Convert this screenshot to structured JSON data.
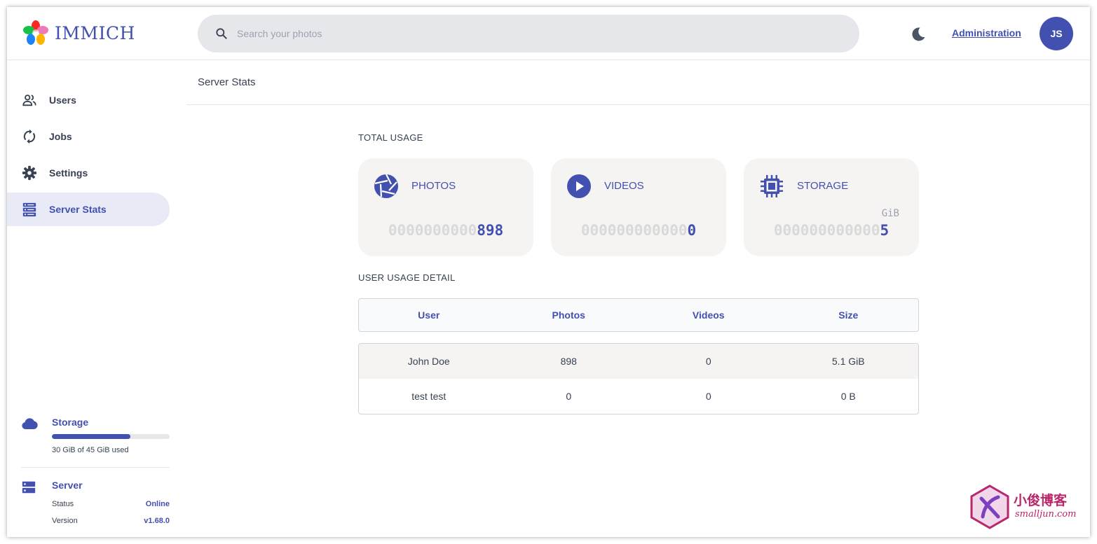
{
  "app": {
    "name": "IMMICH"
  },
  "header": {
    "search_placeholder": "Search your photos",
    "admin_link": "Administration",
    "avatar_initials": "JS"
  },
  "sidebar": {
    "items": [
      {
        "label": "Users",
        "icon": "users-icon",
        "active": false
      },
      {
        "label": "Jobs",
        "icon": "sync-icon",
        "active": false
      },
      {
        "label": "Settings",
        "icon": "gear-icon",
        "active": false
      },
      {
        "label": "Server Stats",
        "icon": "server-icon",
        "active": true
      }
    ],
    "storage": {
      "title": "Storage",
      "used_text": "30 GiB of 45 GiB used",
      "used_fraction": 0.667
    },
    "server": {
      "title": "Server",
      "status_label": "Status",
      "status_value": "Online",
      "version_label": "Version",
      "version_value": "v1.68.0"
    }
  },
  "main": {
    "page_title": "Server Stats",
    "total_usage_label": "TOTAL USAGE",
    "cards": [
      {
        "label": "PHOTOS",
        "icon": "camera-iris-icon",
        "padding": "0000000000",
        "value": "898",
        "unit": ""
      },
      {
        "label": "VIDEOS",
        "icon": "play-circle-icon",
        "padding": "000000000000",
        "value": "0",
        "unit": ""
      },
      {
        "label": "STORAGE",
        "icon": "chip-icon",
        "padding": "000000000000",
        "value": "5",
        "unit": "GiB"
      }
    ],
    "user_usage_label": "USER USAGE DETAIL",
    "table": {
      "headers": [
        "User",
        "Photos",
        "Videos",
        "Size"
      ],
      "rows": [
        [
          "John Doe",
          "898",
          "0",
          "5.1 GiB"
        ],
        [
          "test test",
          "0",
          "0",
          "0 B"
        ]
      ]
    }
  },
  "watermark": {
    "cn": "小俊博客",
    "en": "smalljun.com"
  },
  "colors": {
    "accent": "#4250af",
    "card_bg": "#f5f4f2",
    "search_bg": "#e5e7eb",
    "active_nav_bg": "#e8eaf6"
  }
}
